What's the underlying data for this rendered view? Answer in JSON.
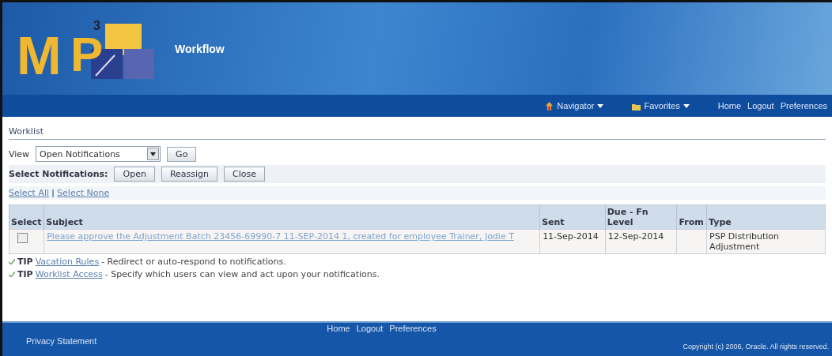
{
  "header": {
    "logo": {
      "main": "M",
      "second": "P",
      "sup": "3"
    },
    "title": "Workflow"
  },
  "nav": {
    "menus": [
      {
        "label": "Navigator",
        "kind": "navigator"
      },
      {
        "label": "Favorites",
        "kind": "favorites"
      }
    ],
    "links": [
      "Home",
      "Logout",
      "Preferences"
    ]
  },
  "worklist": {
    "title": "Worklist",
    "view": {
      "label": "View",
      "value": "Open Notifications",
      "button": "Go"
    },
    "actions": {
      "label": "Select Notifications:",
      "buttons": [
        "Open",
        "Reassign",
        "Close"
      ]
    },
    "select_links": [
      "Select All",
      "Select None"
    ],
    "table": {
      "columns": [
        "Select",
        "Subject",
        "Sent",
        "Due - Fn Level",
        "From",
        "Type"
      ],
      "rows": [
        {
          "checked": false,
          "subject": "Please approve the Adjustment Batch 23456-69990-7 11-SEP-2014 1, created for employee Trainer, Jodie T",
          "sent": "11-Sep-2014",
          "due": "12-Sep-2014",
          "from": "",
          "type": "PSP Distribution Adjustment"
        }
      ]
    },
    "tips": [
      {
        "label": "TIP",
        "link": "Vacation Rules",
        "text": " - Redirect or auto-respond to notifications."
      },
      {
        "label": "TIP",
        "link": "Worklist Access",
        "text": " - Specify which users can view and act upon your notifications."
      }
    ]
  },
  "footer": {
    "links": [
      "Home",
      "Logout",
      "Preferences"
    ],
    "privacy": "Privacy Statement",
    "copyright": "Copyright (c) 2006, Oracle. All rights reserved."
  }
}
